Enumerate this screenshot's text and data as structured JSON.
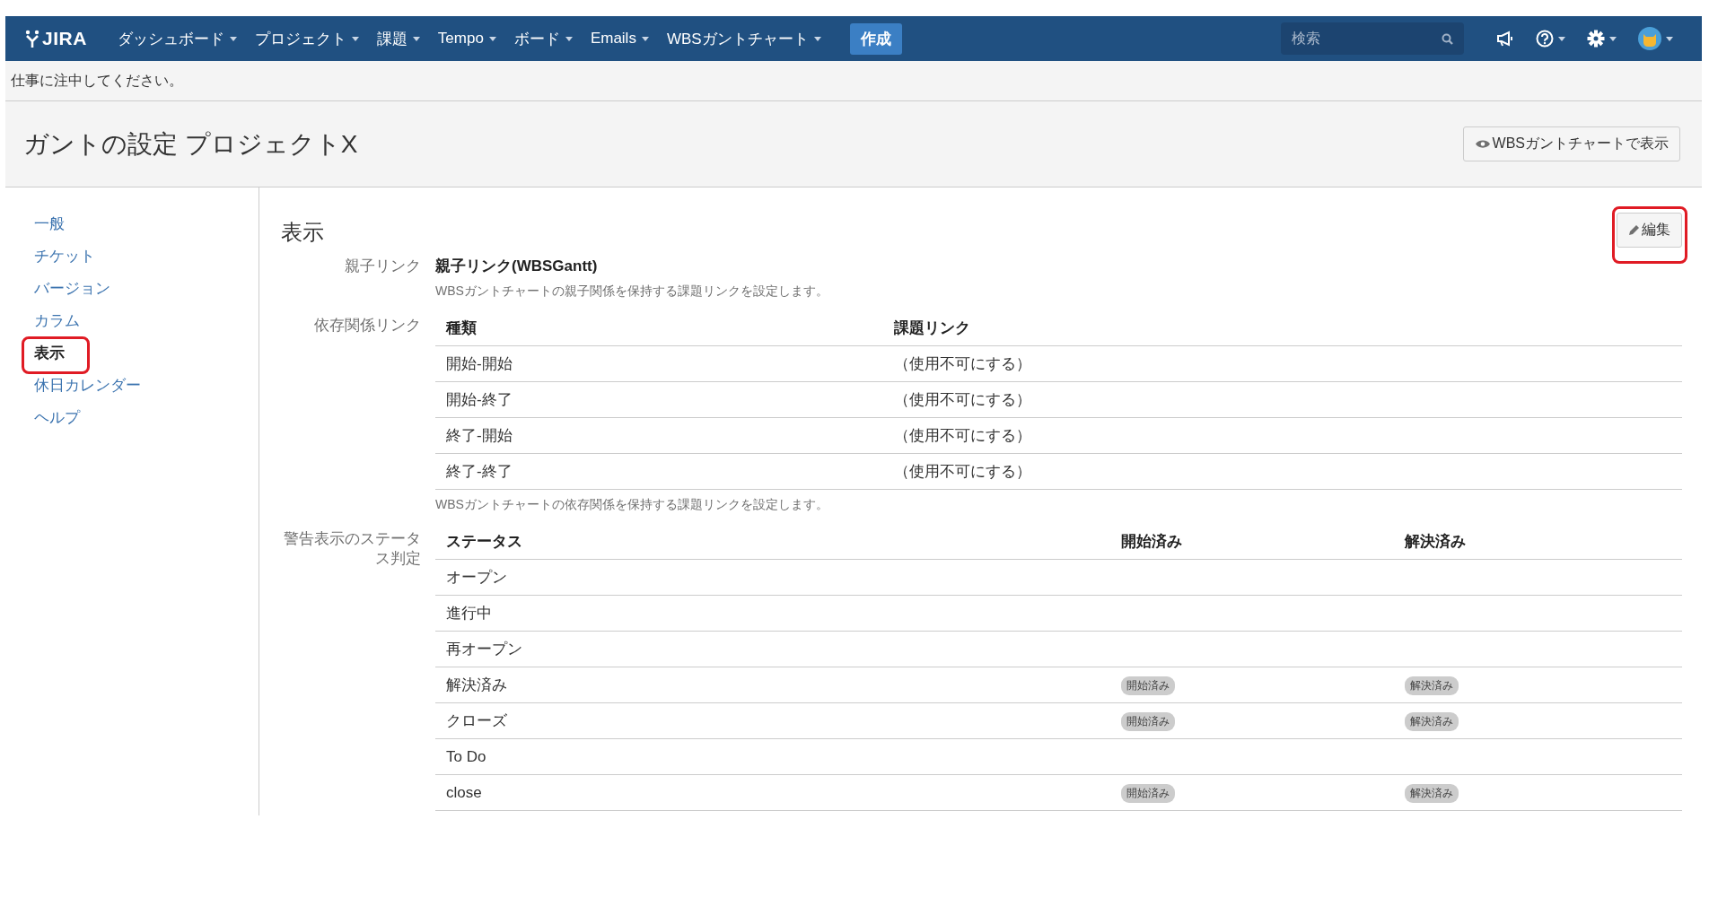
{
  "nav": {
    "logo": "JIRA",
    "menus": [
      {
        "label": "ダッシュボード"
      },
      {
        "label": "プロジェクト"
      },
      {
        "label": "課題"
      },
      {
        "label": "Tempo"
      },
      {
        "label": "ボード"
      },
      {
        "label": "Emails"
      },
      {
        "label": "WBSガントチャート"
      }
    ],
    "create_button": "作成",
    "search": {
      "placeholder": "検索"
    }
  },
  "notice": "仕事に注中してください。",
  "page": {
    "title": "ガントの設定 プロジェクトX",
    "view_button": "WBSガントチャートで表示"
  },
  "sidebar": {
    "items": [
      {
        "label": "一般",
        "selected": false,
        "highlighted": false
      },
      {
        "label": "チケット",
        "selected": false,
        "highlighted": false
      },
      {
        "label": "バージョン",
        "selected": false,
        "highlighted": false
      },
      {
        "label": "カラム",
        "selected": false,
        "highlighted": false
      },
      {
        "label": "表示",
        "selected": true,
        "highlighted": true
      },
      {
        "label": "休日カレンダー",
        "selected": false,
        "highlighted": false
      },
      {
        "label": "ヘルプ",
        "selected": false,
        "highlighted": false
      }
    ]
  },
  "section": {
    "heading": "表示",
    "edit_button": {
      "label": "編集",
      "highlighted": true
    },
    "parent_link": {
      "label": "親子リンク",
      "value": "親子リンク(WBSGantt)",
      "description": "WBSガントチャートの親子関係を保持する課題リンクを設定します。"
    },
    "dependency_links": {
      "label": "依存関係リンク",
      "columns": [
        "種類",
        "課題リンク"
      ],
      "rows": [
        [
          "開始-開始",
          "（使用不可にする）"
        ],
        [
          "開始-終了",
          "（使用不可にする）"
        ],
        [
          "終了-開始",
          "（使用不可にする）"
        ],
        [
          "終了-終了",
          "（使用不可にする）"
        ]
      ],
      "description": "WBSガントチャートの依存関係を保持する課題リンクを設定します。"
    },
    "warning_status": {
      "label": "警告表示のステータス判定",
      "columns": [
        "ステータス",
        "開始済み",
        "解決済み"
      ],
      "rows": [
        {
          "status": "オープン"
        },
        {
          "status": "進行中"
        },
        {
          "status": "再オープン"
        },
        {
          "status": "解決済み",
          "started": "開始済み",
          "resolved": "解決済み"
        },
        {
          "status": "クローズ",
          "started": "開始済み",
          "resolved": "解決済み"
        },
        {
          "status": "To Do"
        },
        {
          "status": "close",
          "started": "開始済み",
          "resolved": "解決済み"
        }
      ]
    }
  }
}
